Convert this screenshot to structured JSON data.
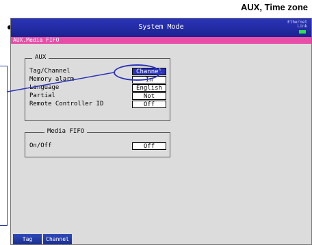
{
  "heading": "AUX, Time zone",
  "window": {
    "title": "System Mode",
    "ethernet_label": "Ethernet",
    "link_label": "Link",
    "tab": "AUX.Media FIFO"
  },
  "aux_group": {
    "title": "AUX",
    "rows": [
      {
        "label": "Tag/Channel",
        "value": "Channel"
      },
      {
        "label": "Memory alarm",
        "value": "In"
      },
      {
        "label": "Language",
        "value": "English"
      },
      {
        "label": "Partial",
        "value": "Not"
      },
      {
        "label": "Remote Controller ID",
        "value": "Off"
      }
    ]
  },
  "media_group": {
    "title": "Media FIFO",
    "rows": [
      {
        "label": "On/Off",
        "value": "Off"
      }
    ]
  },
  "softkeys": [
    "Tag",
    "Channel"
  ],
  "colors": {
    "titlebar": "#2b34b8",
    "tabbar": "#e64ea8",
    "led": "#2ee04a",
    "background": "#dcdcdc"
  }
}
